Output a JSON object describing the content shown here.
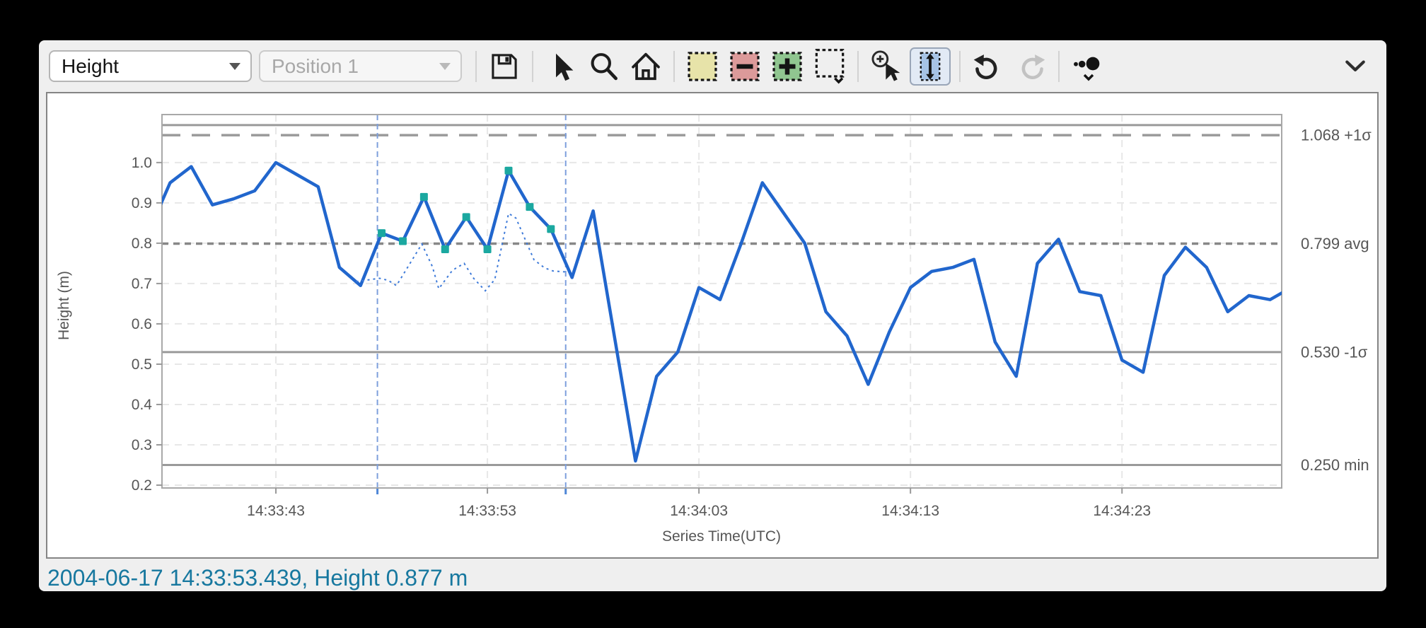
{
  "toolbar": {
    "series_dropdown": {
      "value": "Height"
    },
    "position_dropdown": {
      "value": "Position 1"
    },
    "buttons": [
      {
        "name": "save"
      },
      {
        "name": "pointer-select"
      },
      {
        "name": "zoom"
      },
      {
        "name": "home"
      },
      {
        "name": "region-highlight"
      },
      {
        "name": "region-subtract"
      },
      {
        "name": "region-add"
      },
      {
        "name": "region-clear",
        "has_menu": true
      },
      {
        "name": "zoom-in-drag"
      },
      {
        "name": "fit-vertical",
        "active": true
      },
      {
        "name": "undo"
      },
      {
        "name": "redo",
        "disabled": true
      },
      {
        "name": "point-decimation",
        "has_menu": true
      },
      {
        "name": "collapse-toolbar"
      }
    ]
  },
  "status_bar": {
    "text": "2004-06-17 14:33:53.439, Height 0.877 m"
  },
  "chart_data": {
    "type": "line",
    "xlabel": "Series Time(UTC)",
    "ylabel": "Height (m)",
    "x_unit": "seconds after 14:33:00 UTC",
    "xlim_seconds": [
      37.615,
      90.55
    ],
    "ylim": [
      0.193,
      1.119
    ],
    "grid": true,
    "x_ticks": [
      {
        "t": 43,
        "label": "14:33:43"
      },
      {
        "t": 53,
        "label": "14:33:53"
      },
      {
        "t": 63,
        "label": "14:34:03"
      },
      {
        "t": 73,
        "label": "14:34:13"
      },
      {
        "t": 83,
        "label": "14:34:23"
      }
    ],
    "y_ticks": [
      {
        "v": 1.0,
        "label": "1.0"
      },
      {
        "v": 0.9,
        "label": "0.9"
      },
      {
        "v": 0.8,
        "label": "0.8"
      },
      {
        "v": 0.7,
        "label": "0.7"
      },
      {
        "v": 0.6,
        "label": "0.6"
      },
      {
        "v": 0.5,
        "label": "0.5"
      },
      {
        "v": 0.4,
        "label": "0.4"
      },
      {
        "v": 0.3,
        "label": "0.3"
      },
      {
        "v": 0.2,
        "label": "0.2"
      }
    ],
    "reference_lines": [
      {
        "value": 1.093,
        "style": "solid",
        "label": ""
      },
      {
        "value": 1.068,
        "style": "long-dash",
        "label": "1.068 +1σ"
      },
      {
        "value": 0.799,
        "style": "short-dash",
        "label": "0.799 avg"
      },
      {
        "value": 0.53,
        "style": "solid",
        "label": "0.530 -1σ"
      },
      {
        "value": 0.25,
        "style": "solid",
        "label": "0.250 min"
      }
    ],
    "selection": {
      "start_t": 47.8,
      "end_t": 56.7
    },
    "series": [
      {
        "name": "Height",
        "style": "solid",
        "points": [
          [
            37.0,
            0.83
          ],
          [
            38,
            0.95
          ],
          [
            39,
            0.99
          ],
          [
            40,
            0.895
          ],
          [
            41,
            0.91
          ],
          [
            42,
            0.93
          ],
          [
            43,
            1.0
          ],
          [
            44,
            0.97
          ],
          [
            45,
            0.94
          ],
          [
            46,
            0.74
          ],
          [
            47,
            0.695
          ],
          [
            48,
            0.825
          ],
          [
            49,
            0.805
          ],
          [
            50,
            0.915
          ],
          [
            51,
            0.785
          ],
          [
            52,
            0.865
          ],
          [
            53,
            0.785
          ],
          [
            54,
            0.98
          ],
          [
            55,
            0.89
          ],
          [
            56,
            0.835
          ],
          [
            57,
            0.715
          ],
          [
            58,
            0.88
          ],
          [
            59,
            0.57
          ],
          [
            60,
            0.26
          ],
          [
            61,
            0.47
          ],
          [
            62,
            0.53
          ],
          [
            63,
            0.69
          ],
          [
            64,
            0.66
          ],
          [
            65,
            0.8
          ],
          [
            66,
            0.95
          ],
          [
            67,
            0.875
          ],
          [
            68,
            0.8
          ],
          [
            69,
            0.63
          ],
          [
            70,
            0.57
          ],
          [
            71,
            0.45
          ],
          [
            72,
            0.58
          ],
          [
            73,
            0.69
          ],
          [
            74,
            0.73
          ],
          [
            75,
            0.74
          ],
          [
            76,
            0.76
          ],
          [
            77,
            0.555
          ],
          [
            78,
            0.47
          ],
          [
            79,
            0.75
          ],
          [
            80,
            0.81
          ],
          [
            81,
            0.68
          ],
          [
            82,
            0.67
          ],
          [
            83,
            0.51
          ],
          [
            84,
            0.48
          ],
          [
            85,
            0.72
          ],
          [
            86,
            0.79
          ],
          [
            87,
            0.74
          ],
          [
            88,
            0.63
          ],
          [
            89,
            0.67
          ],
          [
            90,
            0.66
          ],
          [
            91,
            0.69
          ]
        ]
      },
      {
        "name": "dotted_overlay",
        "style": "dotted",
        "points": [
          [
            46.8,
            0.705
          ],
          [
            47.9,
            0.713
          ],
          [
            48.3,
            0.708
          ],
          [
            48.7,
            0.695
          ],
          [
            49.9,
            0.798
          ],
          [
            50.4,
            0.742
          ],
          [
            50.7,
            0.687
          ],
          [
            51.35,
            0.733
          ],
          [
            51.9,
            0.75
          ],
          [
            52.35,
            0.713
          ],
          [
            52.9,
            0.682
          ],
          [
            53.35,
            0.71
          ],
          [
            54.0,
            0.874
          ],
          [
            54.35,
            0.862
          ],
          [
            55.2,
            0.759
          ],
          [
            55.7,
            0.739
          ],
          [
            56.1,
            0.731
          ],
          [
            56.67,
            0.729
          ]
        ]
      }
    ],
    "markers": {
      "points": [
        [
          48,
          0.825
        ],
        [
          49,
          0.805
        ],
        [
          50,
          0.915
        ],
        [
          51,
          0.785
        ],
        [
          52,
          0.865
        ],
        [
          53,
          0.785
        ],
        [
          54,
          0.98
        ],
        [
          55,
          0.89
        ],
        [
          56,
          0.835
        ]
      ]
    },
    "colors": {
      "line": "#2166cd",
      "dotted_line": "#3f7bd9",
      "marker": "#1ba8a0",
      "selection": "#7d9fdc",
      "selection_tick": "#4f87d7",
      "grid": "#e7e7e7",
      "ref_line": "#9a9a9a",
      "axis_text": "#565656",
      "status_text": "#17789f"
    }
  }
}
